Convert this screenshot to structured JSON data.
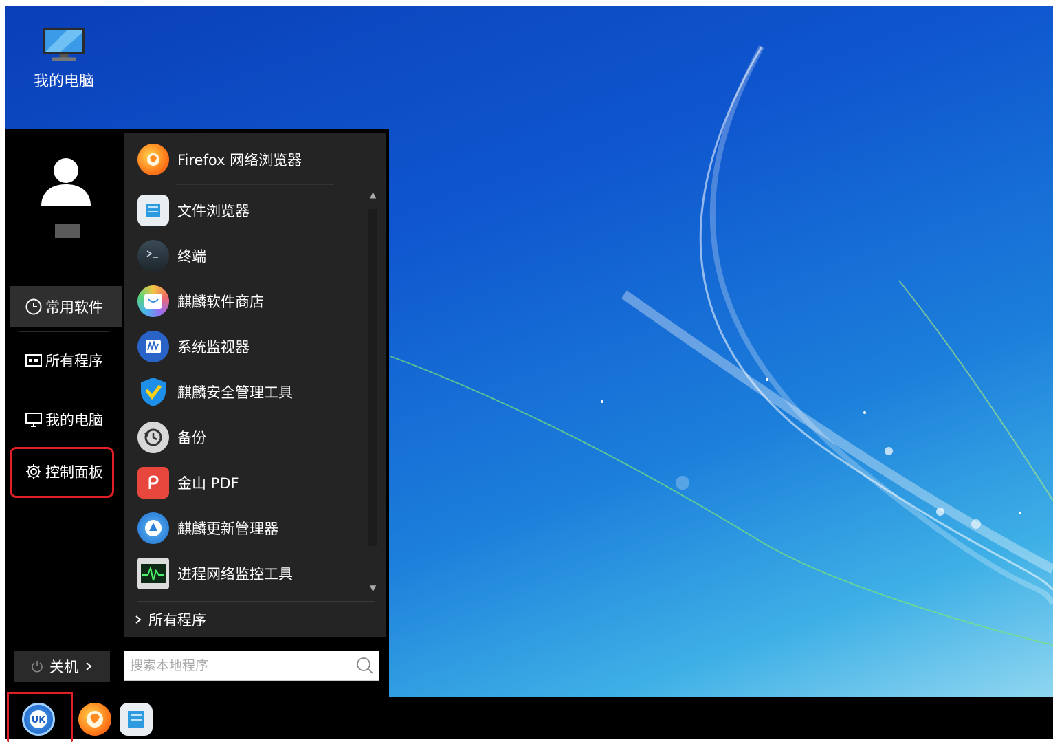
{
  "desktop": {
    "icons": [
      {
        "label": "我的电脑",
        "icon": "computer-icon"
      }
    ]
  },
  "start_menu": {
    "user": {
      "avatar_icon": "user-avatar-icon"
    },
    "nav": [
      {
        "label": "常用软件",
        "icon": "clock-icon",
        "active": true
      },
      {
        "label": "所有程序",
        "icon": "grid-icon"
      },
      {
        "label": "我的电脑",
        "icon": "monitor-icon"
      },
      {
        "label": "控制面板",
        "icon": "gear-icon"
      }
    ],
    "shutdown_label": "关机",
    "apps": [
      {
        "label": "Firefox 网络浏览器",
        "icon": "firefox-icon"
      },
      {
        "label": "文件浏览器",
        "icon": "file-manager-icon"
      },
      {
        "label": "终端",
        "icon": "terminal-icon"
      },
      {
        "label": "麒麟软件商店",
        "icon": "software-store-icon"
      },
      {
        "label": "系统监视器",
        "icon": "system-monitor-icon"
      },
      {
        "label": "麒麟安全管理工具",
        "icon": "security-shield-icon"
      },
      {
        "label": "备份",
        "icon": "backup-icon"
      },
      {
        "label": "金山 PDF",
        "icon": "pdf-icon"
      },
      {
        "label": "麒麟更新管理器",
        "icon": "update-manager-icon"
      },
      {
        "label": "进程网络监控工具",
        "icon": "network-monitor-icon"
      }
    ],
    "all_programs_label": "所有程序",
    "search": {
      "placeholder": "搜索本地程序"
    }
  },
  "taskbar": {
    "items": [
      {
        "icon": "ukui-start-icon"
      },
      {
        "icon": "firefox-icon"
      },
      {
        "icon": "file-manager-icon"
      }
    ]
  },
  "colors": {
    "highlight": "#e01f26",
    "menu_bg": "#000000",
    "app_panel_bg": "#242424"
  }
}
